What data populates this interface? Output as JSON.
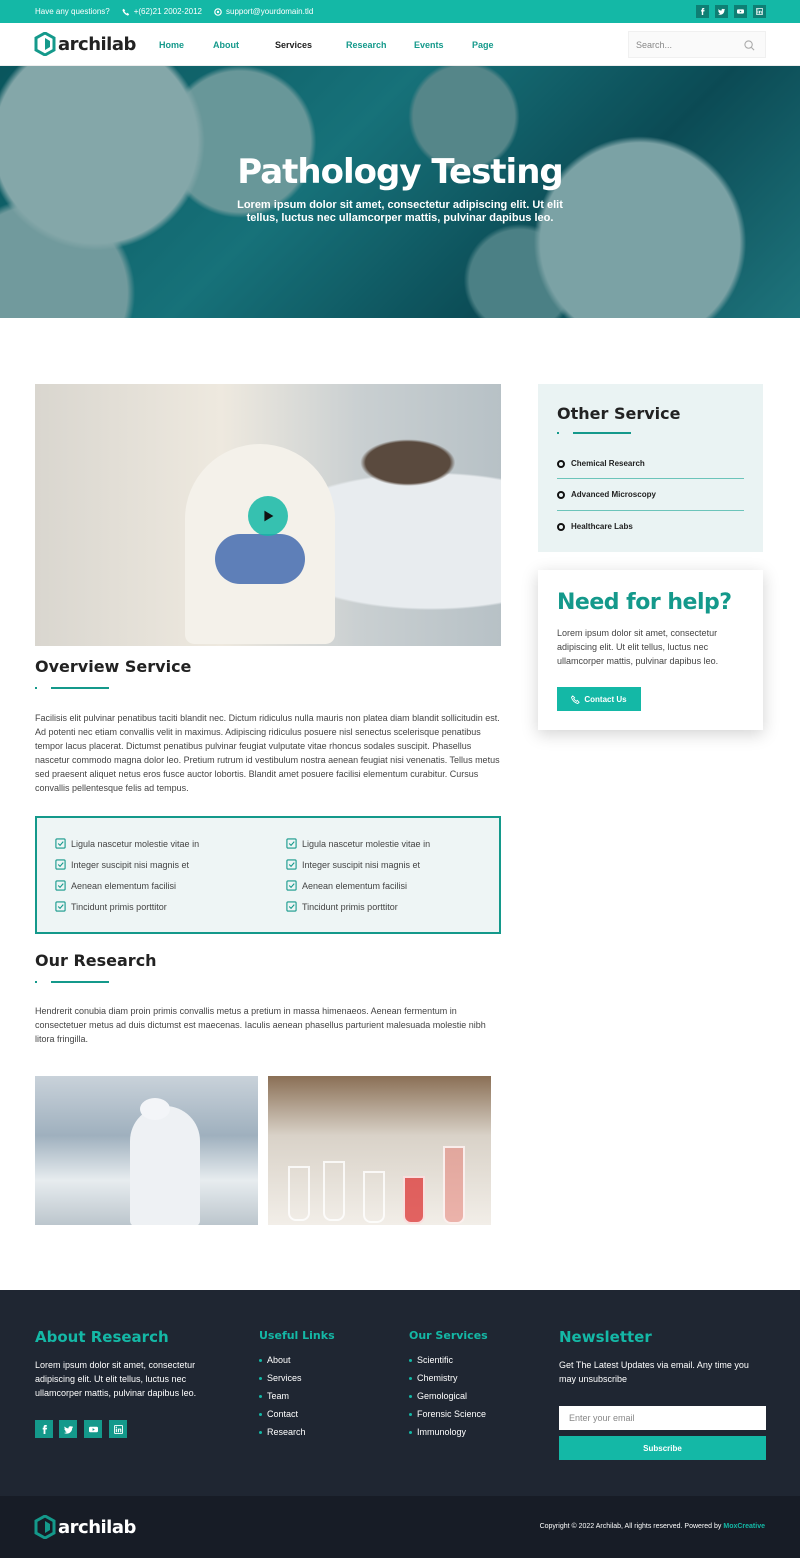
{
  "topbar": {
    "question": "Have any questions?",
    "phone": "+(62)21 2002-2012",
    "email": "support@yourdomain.tld",
    "social": [
      "facebook-icon",
      "twitter-icon",
      "youtube-icon",
      "linkedin-icon"
    ]
  },
  "header": {
    "logo": "archilab",
    "nav": [
      "Home",
      "About",
      "Services",
      "Research",
      "Events",
      "Page"
    ],
    "search_placeholder": "Search..."
  },
  "hero": {
    "title": "Pathology Testing",
    "subtitle": "Lorem ipsum dolor sit amet, consectetur adipiscing elit. Ut elit tellus, luctus nec ullamcorper mattis, pulvinar dapibus leo."
  },
  "overview": {
    "title": "Overview Service",
    "text": "Facilisis elit pulvinar penatibus taciti blandit nec. Dictum ridiculus nulla mauris non platea diam blandit sollicitudin est. Ad potenti nec etiam convallis velit in maximus. Adipiscing ridiculus posuere nisl senectus scelerisque penatibus tempor lacus placerat. Dictumst penatibus pulvinar feugiat vulputate vitae rhoncus sodales suscipit. Phasellus nascetur commodo magna dolor leo. Pretium rutrum id vestibulum nostra aenean feugiat nisi venenatis. Tellus metus sed praesent aliquet netus eros fusce auctor lobortis. Blandit amet posuere facilisi elementum curabitur. Cursus convallis pellentesque felis ad tempus.",
    "checklist_left": [
      "Ligula nascetur molestie vitae in",
      "Integer suscipit nisi magnis et",
      "Aenean elementum facilisi",
      "Tincidunt primis porttitor"
    ],
    "checklist_right": [
      "Ligula nascetur molestie vitae in",
      "Integer suscipit nisi magnis et",
      "Aenean elementum facilisi",
      "Tincidunt primis porttitor"
    ]
  },
  "research": {
    "title": "Our Research",
    "text": "Hendrerit conubia diam proin primis convallis metus a pretium in massa himenaeos. Aenean fermentum in consectetuer metus ad duis dictumst est maecenas. Iaculis aenean phasellus parturient malesuada molestie nibh litora fringilla."
  },
  "sidebar": {
    "other_title": "Other Service",
    "other_items": [
      "Chemical Research",
      "Advanced Microscopy",
      "Healthcare Labs"
    ],
    "help_title": "Need for help?",
    "help_text": "Lorem ipsum dolor sit amet, consectetur adipiscing elit. Ut elit tellus, luctus nec ullamcorper mattis, pulvinar dapibus leo.",
    "help_button": "Contact Us"
  },
  "footer": {
    "about_title": "About Research",
    "about_text": "Lorem ipsum dolor sit amet, consectetur adipiscing elit. Ut elit tellus, luctus nec ullamcorper mattis, pulvinar dapibus leo.",
    "links_title": "Useful Links",
    "links": [
      "About",
      "Services",
      "Team",
      "Contact",
      "Research"
    ],
    "services_title": "Our Services",
    "services": [
      "Scientific",
      "Chemistry",
      "Gemological",
      "Forensic Science",
      "Immunology"
    ],
    "newsletter_title": "Newsletter",
    "newsletter_text": "Get The Latest Updates via email. Any time you may unsubscribe",
    "email_placeholder": "Enter your email",
    "subscribe": "Subscribe",
    "logo": "archilab",
    "copyright": "Copyright © 2022 Archilab, All rights reserved. Powered by",
    "powered_by": "MoxCreative"
  }
}
